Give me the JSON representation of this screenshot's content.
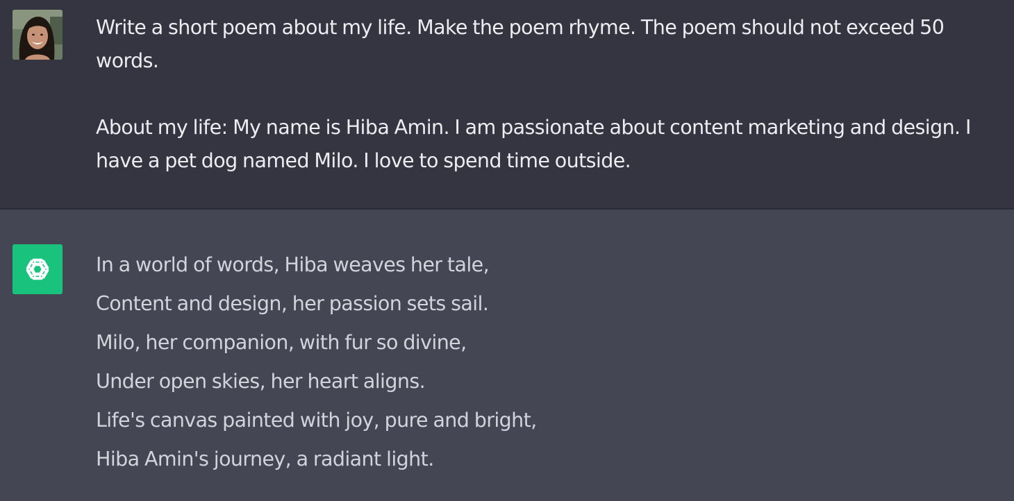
{
  "conversation": {
    "user_message": {
      "avatar": "user-avatar-photo",
      "line1": "Write a short poem about my life. Make the poem rhyme. The poem should not exceed 50 words.",
      "line2": "About my life:  My name is Hiba Amin. I am passionate about content marketing and design. I have a pet dog named Milo. I love to spend time outside."
    },
    "assistant_message": {
      "avatar": "openai-logo-icon",
      "avatar_color": "#19c37d",
      "poem_lines": [
        "In a world of words, Hiba weaves her tale,",
        "Content and design, her passion sets sail.",
        "Milo, her companion, with fur so divine,",
        "Under open skies, her heart aligns.",
        "Life's canvas painted with joy, pure and bright,",
        "Hiba Amin's journey, a radiant light."
      ]
    }
  },
  "colors": {
    "user_bg": "#343541",
    "assistant_bg": "#444654",
    "text": "#ececf1",
    "assistant_text": "#d1d5db"
  }
}
